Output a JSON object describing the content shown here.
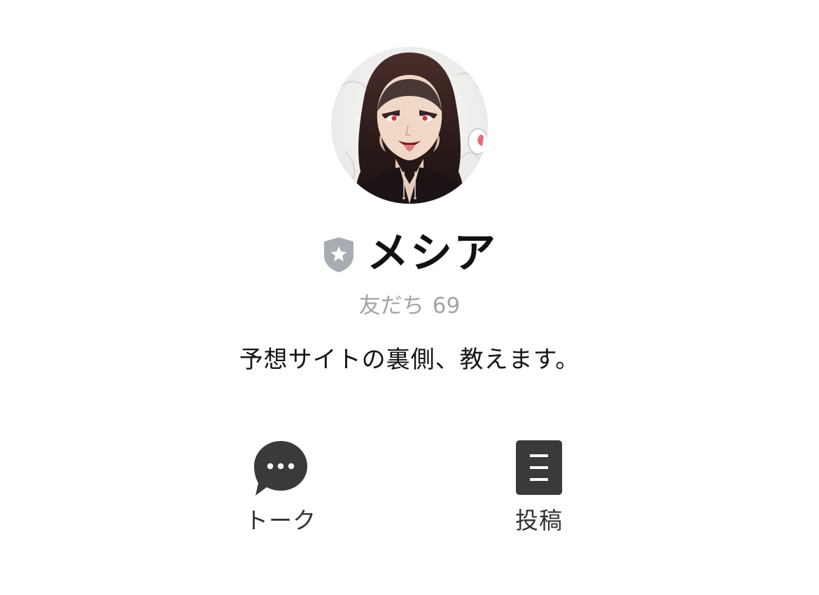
{
  "profile": {
    "name": "メシア",
    "friends_label": "友だち",
    "friends_count": "69",
    "status_message": "予想サイトの裏側、教えます。",
    "avatar_icon": "hooded-character-avatar",
    "badge_icon": "verified-shield-star-icon"
  },
  "actions": {
    "talk": {
      "label": "トーク",
      "icon": "chat-bubble-icon"
    },
    "posts": {
      "label": "投稿",
      "icon": "posts-list-icon"
    }
  },
  "colors": {
    "background": "#ffffff",
    "name_text": "#111111",
    "friends_text": "#a4a4a4",
    "icon_dark": "#3a3a3a",
    "badge_gray": "#a7adb3"
  }
}
